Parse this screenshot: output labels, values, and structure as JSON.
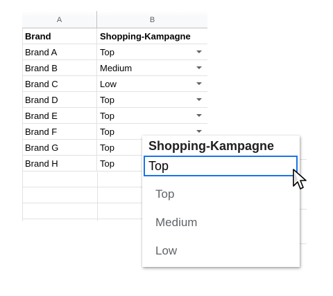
{
  "sheet": {
    "columns": [
      "A",
      "B"
    ],
    "header": {
      "brand": "Brand",
      "campaign": "Shopping-Kampagne"
    },
    "rows": [
      {
        "brand": "Brand A",
        "campaign": "Top"
      },
      {
        "brand": "Brand B",
        "campaign": "Medium"
      },
      {
        "brand": "Brand C",
        "campaign": "Low"
      },
      {
        "brand": "Brand D",
        "campaign": "Top"
      },
      {
        "brand": "Brand E",
        "campaign": "Top"
      },
      {
        "brand": "Brand F",
        "campaign": "Top"
      },
      {
        "brand": "Brand G",
        "campaign": "Top"
      },
      {
        "brand": "Brand H",
        "campaign": "Top"
      }
    ]
  },
  "popup": {
    "title": "Shopping-Kampagne",
    "selected_value": "Top",
    "options": [
      "Top",
      "Medium",
      "Low"
    ]
  },
  "icons": {
    "dropdown": "chevron-down-icon",
    "cursor": "mouse-pointer-icon"
  },
  "colors": {
    "focus_border": "#1a73e8",
    "option_text": "#5f6368",
    "caret": "#5f6368"
  }
}
